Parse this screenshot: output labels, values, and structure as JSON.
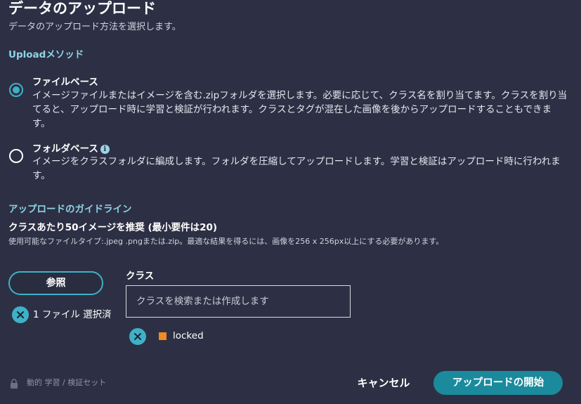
{
  "header": {
    "title": "データのアップロード",
    "subtitle": "データのアップロード方法を選択します。"
  },
  "upload_method": {
    "label": "Uploadメソッド",
    "options": [
      {
        "title": "ファイルベース",
        "description": "イメージファイルまたはイメージを含む.zipフォルダを選択します。必要に応じて、クラス名を割り当てます。クラスを割り当てると、アップロード時に学習と検証が行われます。クラスとタグが混在した画像を後からアップロードすることもできます。",
        "selected": true
      },
      {
        "title": "フォルダベース",
        "description": "イメージをクラスフォルダに編成します。フォルダを圧縮してアップロードします。学習と検証はアップロード時に行われます。",
        "selected": false,
        "info_icon": "i"
      }
    ]
  },
  "guidelines": {
    "label": "アップロードのガイドライン",
    "recommendation": "クラスあたり50イメージを推奨 (最小要件は20)",
    "details": "使用可能なファイルタイプ:.jpeg .pngまたは.zip。最適な結果を得るには、画像を256 x 256px以上にする必要があります。"
  },
  "browse": {
    "button_label": "参照",
    "file_count": "1 ファイル 選択済"
  },
  "class_field": {
    "label": "クラス",
    "placeholder": "クラスを検索または作成します",
    "value": ""
  },
  "tags": [
    {
      "label": "locked",
      "color": "#f08a24"
    }
  ],
  "footer": {
    "lock_text": "動的 学習 / 検証セット",
    "cancel_label": "キャンセル",
    "start_label": "アップロードの開始"
  },
  "colors": {
    "background": "#2d3044",
    "accent": "#3fb1c6",
    "primary_button": "#1b8a9d",
    "section_label": "#8fd3e6",
    "tag": "#f08a24"
  },
  "icons": [
    "radio-selected-icon",
    "radio-unselected-icon",
    "info-icon",
    "remove-file-icon",
    "remove-tag-icon",
    "lock-icon"
  ]
}
